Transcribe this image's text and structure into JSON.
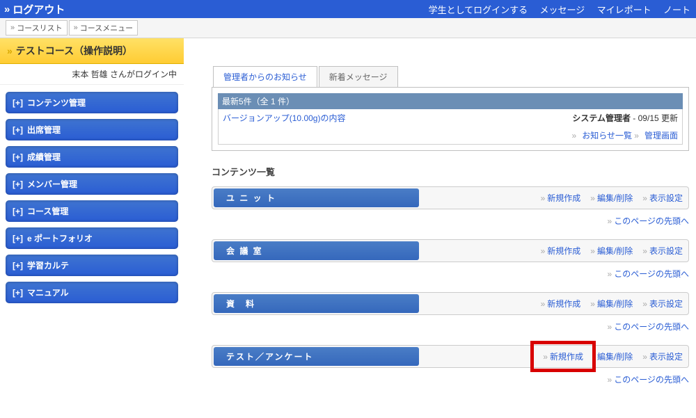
{
  "topbar": {
    "logout": "ログアウト",
    "login_as_student": "学生としてログインする",
    "messages": "メッセージ",
    "my_reports": "マイレポート",
    "notes": "ノート"
  },
  "breadcrumb": {
    "course_list": "コースリスト",
    "course_menu": "コースメニュー"
  },
  "sidebar": {
    "course_title": "テストコース（操作説明）",
    "logged_in": "末本 哲雄 さんがログイン中",
    "items": [
      {
        "prefix": "[+]",
        "label": "コンテンツ管理"
      },
      {
        "prefix": "[+]",
        "label": "出席管理"
      },
      {
        "prefix": "[+]",
        "label": "成績管理"
      },
      {
        "prefix": "[+]",
        "label": "メンバー管理"
      },
      {
        "prefix": "[+]",
        "label": "コース管理"
      },
      {
        "prefix": "[+]",
        "label": "e ポートフォリオ"
      },
      {
        "prefix": "[+]",
        "label": "学習カルテ"
      },
      {
        "prefix": "[+]",
        "label": "マニュアル"
      }
    ]
  },
  "tabs": {
    "admin_notice": "管理者からのお知らせ",
    "new_messages": "新着メッセージ"
  },
  "news": {
    "head": "最新5件（全 1 件）",
    "item_title": "バージョンアップ(10.00g)の内容",
    "item_source": "システム管理者",
    "item_date": " - 09/15 更新",
    "link_all": "お知らせ一覧",
    "link_admin": "管理画面"
  },
  "section_heading": "コンテンツ一覧",
  "actions": {
    "create": "新規作成",
    "edit": "編集/削除",
    "display": "表示設定"
  },
  "page_top": "このページの先頭へ",
  "blocks": {
    "unit": "ユ ニ ッ ト",
    "meeting": "会 議 室",
    "material": "資　料",
    "test": "テスト／アンケート"
  }
}
